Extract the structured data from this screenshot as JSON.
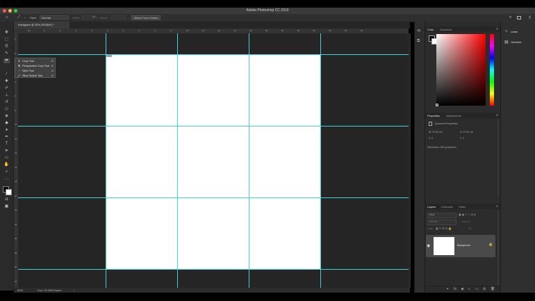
{
  "window": {
    "title": "Adobe Photoshop CC 2019",
    "traffic_colors": [
      "#fc5753",
      "#fdbc40",
      "#33c748"
    ]
  },
  "options_bar": {
    "style_label": "Style:",
    "style_value": "Normal",
    "width_label": "Width:",
    "height_label": "Height:",
    "button_label": "Slices From Guides"
  },
  "document": {
    "tab_title": "Instagram @ 50% (RGB/8*) *",
    "zoom": "50%",
    "doc_info": "Doc: 20.0M/0 bytes",
    "ruler_top": [
      "10",
      "8",
      "6",
      "4",
      "2",
      "0",
      "2",
      "4",
      "6",
      "8",
      "10",
      "12",
      "14",
      "16",
      "18",
      "20",
      "22",
      "24",
      "26",
      "28",
      "30",
      "32"
    ],
    "ruler_left": [
      "2",
      "0",
      "2",
      "4",
      "6",
      "8",
      "10",
      "12",
      "14",
      "16",
      "18",
      "20",
      "22",
      "24",
      "26",
      "28",
      "30",
      "32"
    ]
  },
  "flyout": {
    "items": [
      {
        "label": "Crop Tool",
        "key": "C",
        "icon": "crop-icon"
      },
      {
        "label": "Perspective Crop Tool",
        "key": "C",
        "icon": "perspective-crop-icon"
      },
      {
        "label": "Slice Tool",
        "key": "C",
        "icon": "slice-icon"
      },
      {
        "label": "Slice Select Tool",
        "key": "C",
        "icon": "slice-select-icon"
      }
    ]
  },
  "panels": {
    "color_tabs": [
      "Color",
      "Swatches"
    ],
    "properties_tabs": [
      "Properties",
      "Adjustments"
    ],
    "properties": {
      "section": "Document Properties",
      "w": "W: 27.64 cm",
      "h": "H: 27.64 cm",
      "x": "X: 0",
      "y": "Y: 0",
      "resolution": "Resolution: 300 pixels/inch"
    },
    "layers_tabs": [
      "Layers",
      "Channels",
      "Paths"
    ],
    "layers": {
      "filter_placeholder": "Kind",
      "blend": "Normal",
      "opacity_label": "Opacity:",
      "lock_label": "Lock:",
      "fill_label": "Fill:",
      "layer_name": "Background"
    }
  },
  "right_panel": {
    "items": [
      {
        "label": "Learn",
        "icon": "lightbulb-icon"
      },
      {
        "label": "Libraries",
        "icon": "libraries-icon"
      }
    ]
  },
  "colors": {
    "guide": "#3fd3e0",
    "canvas": "#ffffff"
  }
}
